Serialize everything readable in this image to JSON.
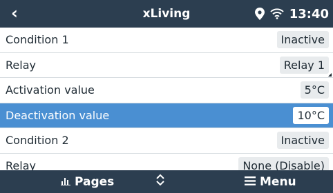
{
  "header": {
    "title": "xLiving",
    "back_icon": "chevron-left-icon",
    "location_icon": "location-pin-icon",
    "wifi_icon": "wifi-icon",
    "clock": "13:40"
  },
  "rows": [
    {
      "label": "Condition 1",
      "value": "Inactive"
    },
    {
      "label": "Relay",
      "value": "Relay 1"
    },
    {
      "label": "Activation value",
      "value": "5°C"
    },
    {
      "label": "Deactivation value",
      "value": "10°C"
    },
    {
      "label": "Condition 2",
      "value": "Inactive"
    },
    {
      "label": "Relay",
      "value": "None (Disable)"
    }
  ],
  "footer": {
    "pages_label": "Pages",
    "pages_icon": "bar-chart-icon",
    "updown_icon": "up-down-chevron-icon",
    "menu_label": "Menu",
    "menu_icon": "hamburger-icon"
  },
  "colors": {
    "bar_background": "#2c3e50",
    "selected_row": "#4a8fd2",
    "value_box": "#e8ebed"
  }
}
